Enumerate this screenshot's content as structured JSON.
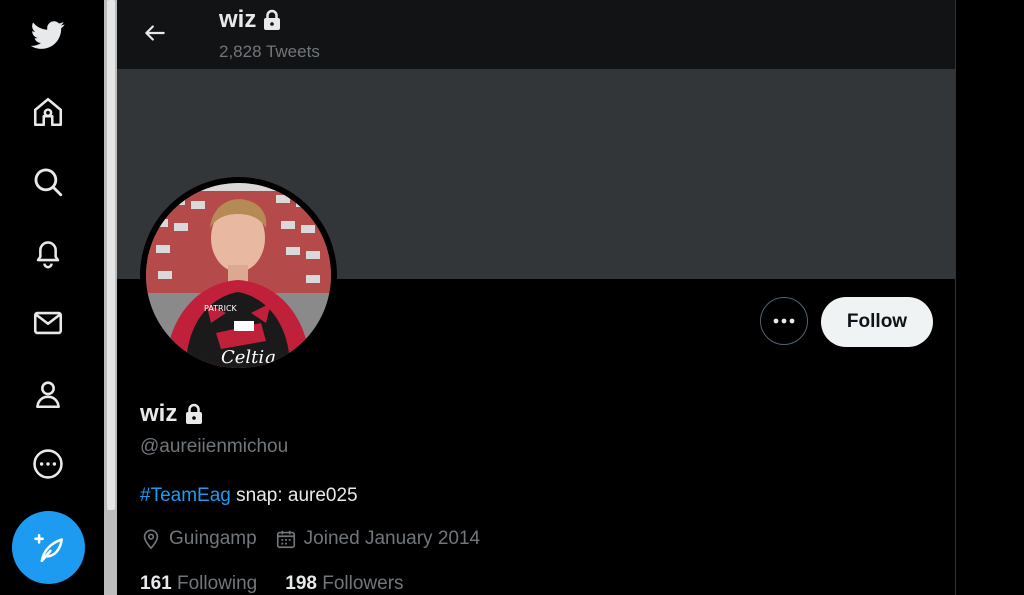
{
  "nav": {
    "items": [
      {
        "icon": "twitter-logo-icon"
      },
      {
        "icon": "home-icon"
      },
      {
        "icon": "search-icon"
      },
      {
        "icon": "notifications-bell-icon"
      },
      {
        "icon": "messages-envelope-icon"
      },
      {
        "icon": "profile-icon"
      },
      {
        "icon": "more-circle-icon"
      }
    ],
    "compose_icon": "compose-tweet-icon"
  },
  "header": {
    "name": "wiz",
    "tweet_count": "2,828 Tweets",
    "back_icon": "back-arrow-icon",
    "lock_icon": "lock-icon"
  },
  "profile": {
    "display_name": "wiz",
    "handle": "@aureiienmichou",
    "bio_hashtag": "#TeamEag",
    "bio_text": " snap: aure025",
    "location": "Guingamp",
    "joined": "Joined January 2014",
    "following_count": "161",
    "following_label": "Following",
    "followers_count": "198",
    "followers_label": "Followers"
  },
  "actions": {
    "follow_label": "Follow",
    "more_icon": "more-dots-icon"
  },
  "colors": {
    "accent": "#1d9bf0",
    "background": "#000000",
    "banner": "#333639",
    "secondary_text": "#71767b"
  }
}
